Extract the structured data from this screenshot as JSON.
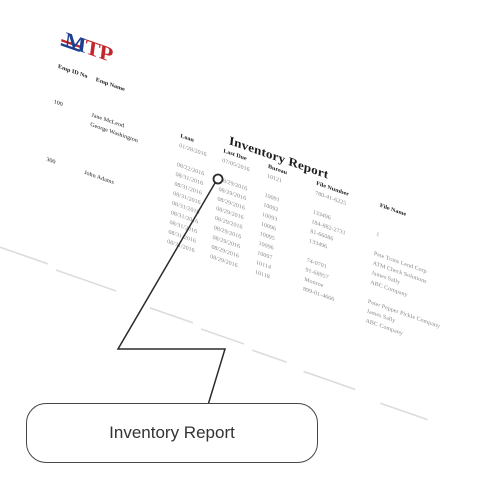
{
  "logo": {
    "text_m": "M",
    "text_tp": "TP"
  },
  "report": {
    "title": "Inventory Report",
    "headers": {
      "emp_id": "Emp ID No",
      "emp_name": "Emp Name",
      "loan": "Loan",
      "last_due": "Last Due",
      "bureau": "Bureau",
      "file_number": "File Number",
      "file_name": "File Name"
    },
    "rows": [
      {
        "emp_id": "100",
        "emp_name": "Jane McLeod",
        "loan": "01/28/2016",
        "last_due": "07/05/2016",
        "bureau": "10121",
        "file_number": "780-41-6225",
        "file_name": ""
      },
      {
        "emp_id": "",
        "emp_name": "George Washington",
        "loan": "",
        "last_due": "",
        "bureau": "",
        "file_number": "",
        "file_name": ""
      },
      {
        "emp_id": "",
        "emp_name": "",
        "loan": "08/22/2016",
        "last_due": "08/29/2016",
        "bureau": "10091",
        "file_number": "133496",
        "file_name": "1"
      },
      {
        "emp_id": "",
        "emp_name": "",
        "loan": "08/31/2016",
        "last_due": "08/29/2016",
        "bureau": "10092",
        "file_number": "184-882-2731",
        "file_name": ""
      },
      {
        "emp_id": "",
        "emp_name": "",
        "loan": "08/31/2016",
        "last_due": "08/29/2016",
        "bureau": "10093",
        "file_number": "81-66086",
        "file_name": "Pete Trans Lend Corp"
      },
      {
        "emp_id": "",
        "emp_name": "",
        "loan": "08/31/2016",
        "last_due": "08/29/2016",
        "bureau": "10096",
        "file_number": "133496",
        "file_name": "ATM Check Solutions"
      },
      {
        "emp_id": "300",
        "emp_name": "John Adams",
        "loan": "08/31/2016",
        "last_due": "08/29/2016",
        "bureau": "10095",
        "file_number": "",
        "file_name": "James Sally"
      },
      {
        "emp_id": "",
        "emp_name": "",
        "loan": "08/31/2016",
        "last_due": "08/29/2016",
        "bureau": "10096",
        "file_number": "74-0701",
        "file_name": "ABC Company"
      },
      {
        "emp_id": "",
        "emp_name": "",
        "loan": "08/31/2016",
        "last_due": "08/29/2016",
        "bureau": "10097",
        "file_number": "91-68957",
        "file_name": ""
      },
      {
        "emp_id": "",
        "emp_name": "",
        "loan": "08/31/2016",
        "last_due": "08/29/2016",
        "bureau": "10114",
        "file_number": "Monroe",
        "file_name": "Peter Pepper Pickle Company"
      },
      {
        "emp_id": "",
        "emp_name": "",
        "loan": "08/31/2016",
        "last_due": "08/29/2016",
        "bureau": "10118",
        "file_number": "899-01-4666",
        "file_name": "James Sally"
      },
      {
        "emp_id": "",
        "emp_name": "",
        "loan": "",
        "last_due": "",
        "bureau": "",
        "file_number": "",
        "file_name": "ABC Company"
      }
    ]
  },
  "callout": {
    "label": "Inventory Report",
    "color": "#2b2b2b"
  }
}
